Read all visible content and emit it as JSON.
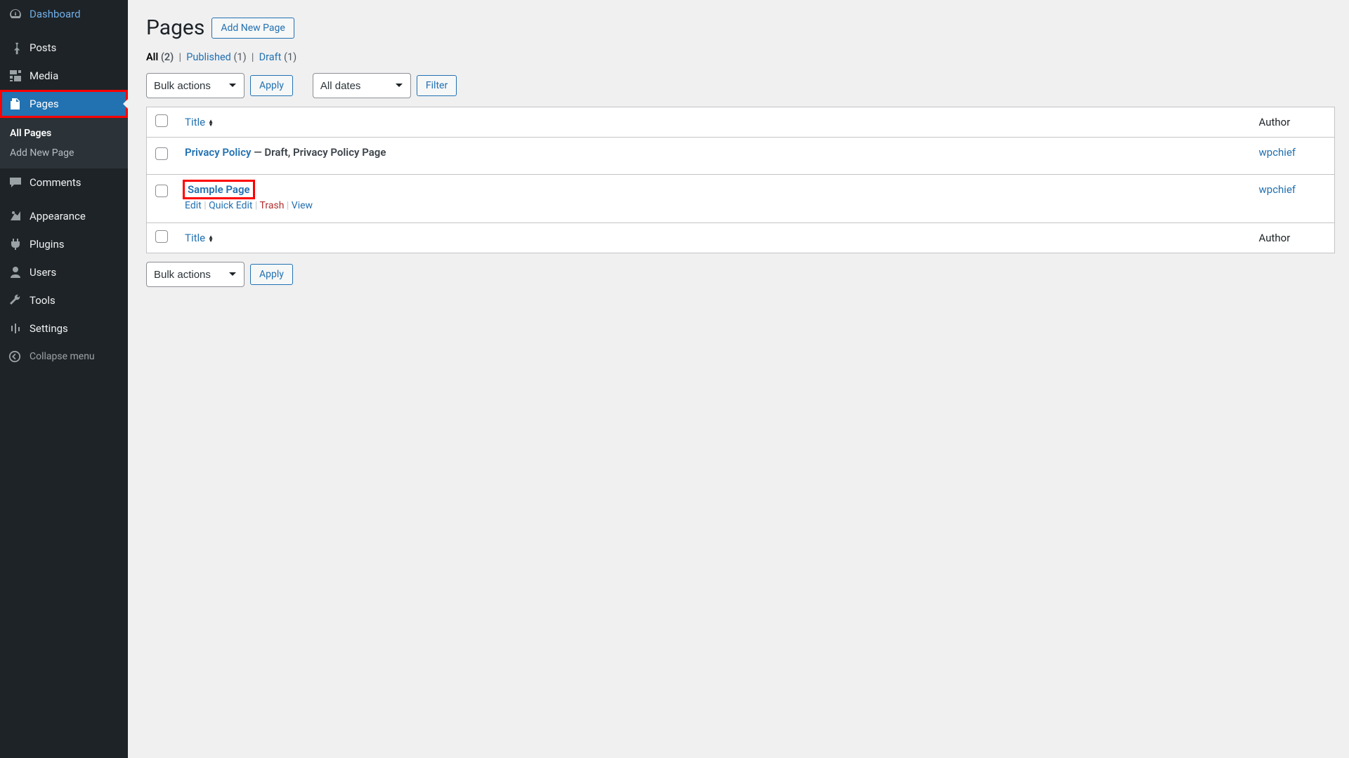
{
  "sidebar": {
    "items": [
      {
        "label": "Dashboard",
        "icon": "dashboard"
      },
      {
        "label": "Posts",
        "icon": "pin"
      },
      {
        "label": "Media",
        "icon": "media"
      },
      {
        "label": "Pages",
        "icon": "pages"
      },
      {
        "label": "Comments",
        "icon": "comments"
      },
      {
        "label": "Appearance",
        "icon": "appearance"
      },
      {
        "label": "Plugins",
        "icon": "plugins"
      },
      {
        "label": "Users",
        "icon": "users"
      },
      {
        "label": "Tools",
        "icon": "tools"
      },
      {
        "label": "Settings",
        "icon": "settings"
      }
    ],
    "submenu": [
      {
        "label": "All Pages"
      },
      {
        "label": "Add New Page"
      }
    ],
    "collapse": "Collapse menu"
  },
  "header": {
    "title": "Pages",
    "add_new": "Add New Page"
  },
  "filters": {
    "all_label": "All",
    "all_count": "(2)",
    "published_label": "Published",
    "published_count": "(1)",
    "draft_label": "Draft",
    "draft_count": "(1)"
  },
  "actions": {
    "bulk": "Bulk actions",
    "apply": "Apply",
    "all_dates": "All dates",
    "filter": "Filter"
  },
  "table": {
    "title_col": "Title",
    "author_col": "Author",
    "rows": [
      {
        "title": "Privacy Policy",
        "state": " — Draft, Privacy Policy Page",
        "author": "wpchief"
      },
      {
        "title": "Sample Page",
        "state": "",
        "author": "wpchief"
      }
    ],
    "row_actions": {
      "edit": "Edit",
      "quick": "Quick Edit",
      "trash": "Trash",
      "view": "View"
    }
  }
}
